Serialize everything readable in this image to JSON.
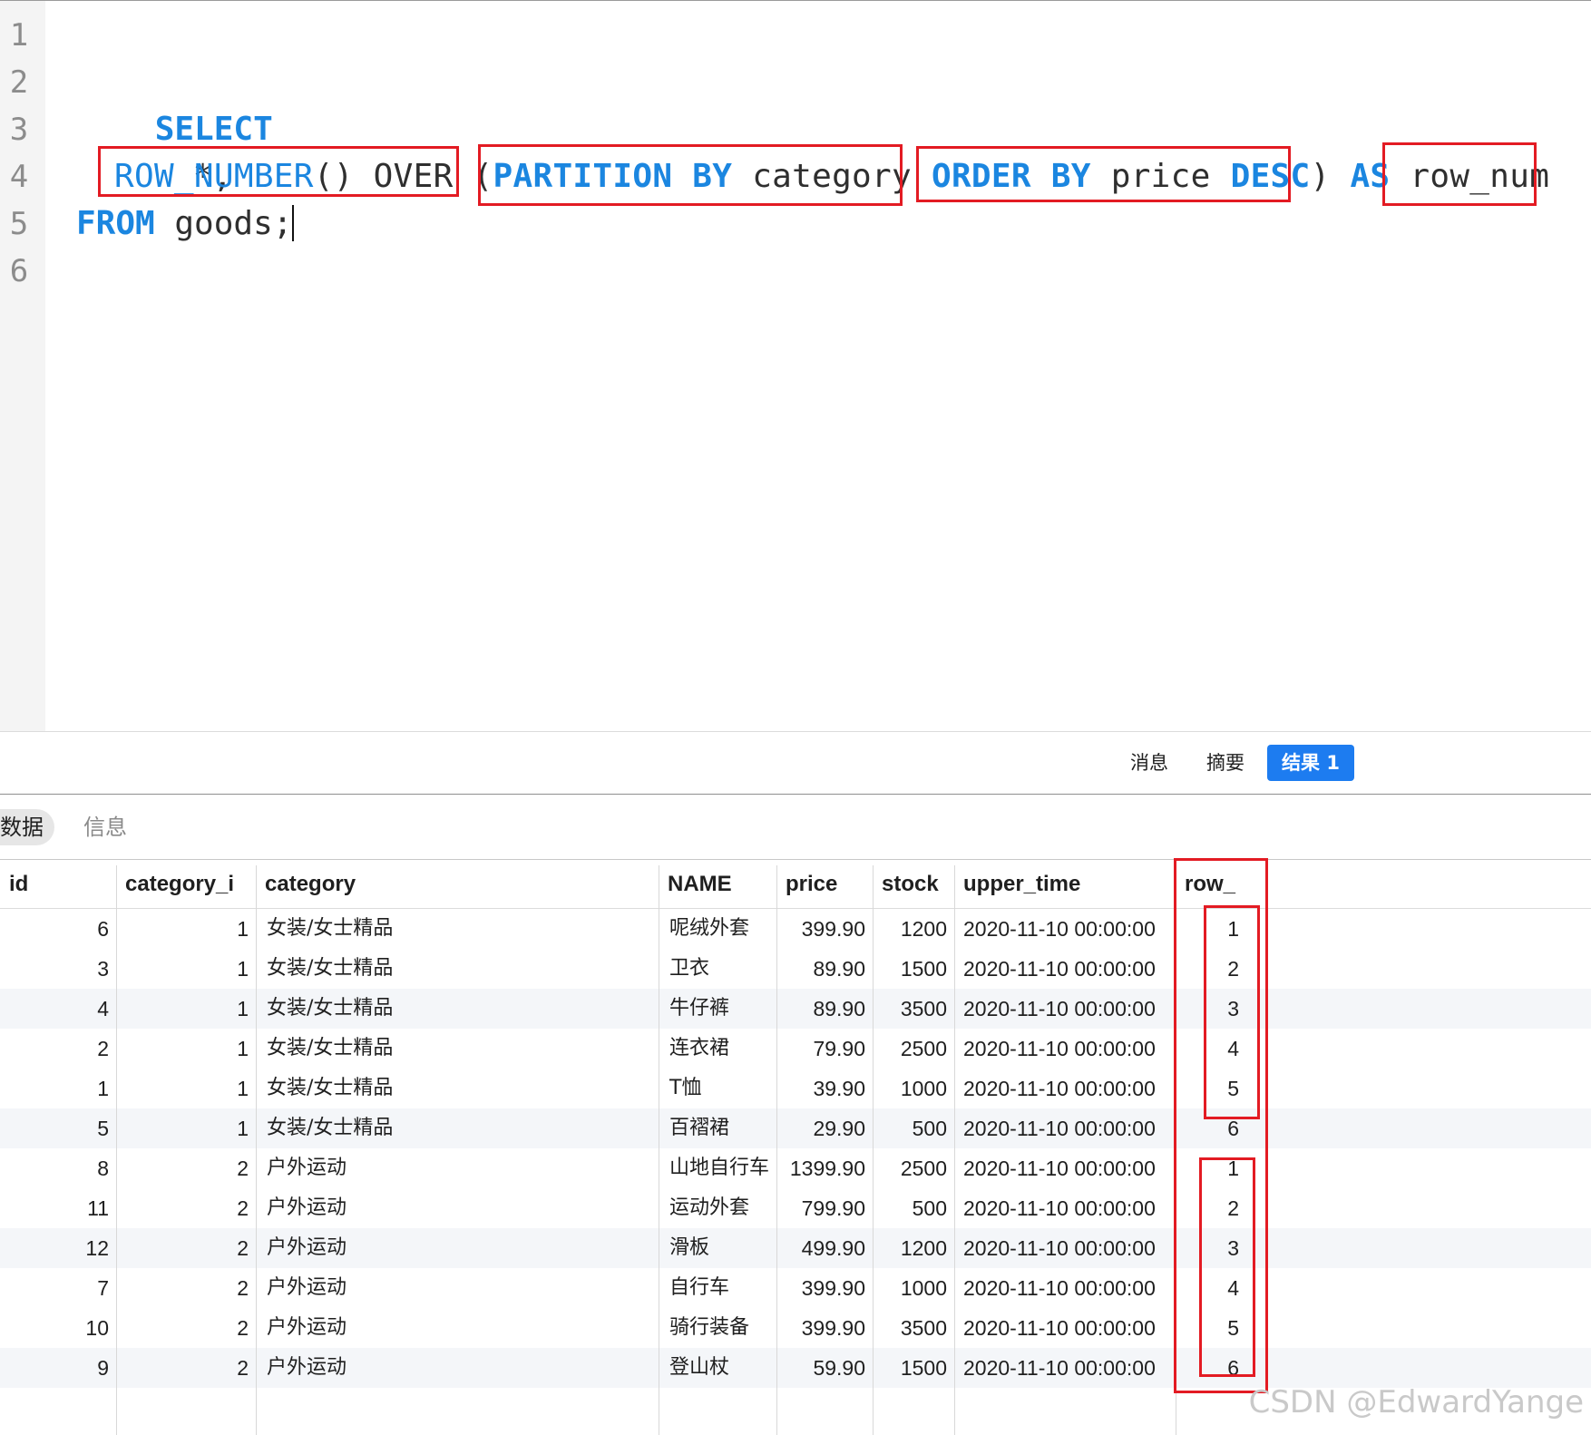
{
  "editor": {
    "line_numbers": [
      "1",
      "2",
      "3",
      "4",
      "5",
      "6"
    ],
    "line2": {
      "kw_select": "SELECT"
    },
    "line3": {
      "star": "*,"
    },
    "line4": {
      "fn_row_number": "ROW_NUMBER",
      "parens": "()",
      "over": " OVER ",
      "open_paren": "(",
      "kw_partition": "PARTITION BY",
      "col_category": " category ",
      "kw_order": "ORDER BY",
      "col_price": " price ",
      "kw_desc": "DESC",
      "close_paren": ")",
      "kw_as": " AS ",
      "alias": "row_num"
    },
    "line5": {
      "kw_from": "FROM",
      "table": " goods;"
    }
  },
  "result_tabs": {
    "message": "消息",
    "summary": "摘要",
    "result1": "结果 1"
  },
  "sub_tabs": {
    "data": "数据",
    "info": "信息"
  },
  "grid": {
    "columns": [
      "id",
      "category_i",
      "category",
      "NAME",
      "price",
      "stock",
      "upper_time",
      "row_"
    ],
    "rows": [
      [
        "6",
        "1",
        "女装/女士精品",
        "呢绒外套",
        "399.90",
        "1200",
        "2020-11-10 00:00:00",
        "1"
      ],
      [
        "3",
        "1",
        "女装/女士精品",
        "卫衣",
        "89.90",
        "1500",
        "2020-11-10 00:00:00",
        "2"
      ],
      [
        "4",
        "1",
        "女装/女士精品",
        "牛仔裤",
        "89.90",
        "3500",
        "2020-11-10 00:00:00",
        "3"
      ],
      [
        "2",
        "1",
        "女装/女士精品",
        "连衣裙",
        "79.90",
        "2500",
        "2020-11-10 00:00:00",
        "4"
      ],
      [
        "1",
        "1",
        "女装/女士精品",
        "T恤",
        "39.90",
        "1000",
        "2020-11-10 00:00:00",
        "5"
      ],
      [
        "5",
        "1",
        "女装/女士精品",
        "百褶裙",
        "29.90",
        "500",
        "2020-11-10 00:00:00",
        "6"
      ],
      [
        "8",
        "2",
        "户外运动",
        "山地自行车",
        "1399.90",
        "2500",
        "2020-11-10 00:00:00",
        "1"
      ],
      [
        "11",
        "2",
        "户外运动",
        "运动外套",
        "799.90",
        "500",
        "2020-11-10 00:00:00",
        "2"
      ],
      [
        "12",
        "2",
        "户外运动",
        "滑板",
        "499.90",
        "1200",
        "2020-11-10 00:00:00",
        "3"
      ],
      [
        "7",
        "2",
        "户外运动",
        "自行车",
        "399.90",
        "1000",
        "2020-11-10 00:00:00",
        "4"
      ],
      [
        "10",
        "2",
        "户外运动",
        "骑行装备",
        "399.90",
        "3500",
        "2020-11-10 00:00:00",
        "5"
      ],
      [
        "9",
        "2",
        "户外运动",
        "登山杖",
        "59.90",
        "1500",
        "2020-11-10 00:00:00",
        "6"
      ]
    ]
  },
  "watermark": "CSDN @EdwardYange",
  "colors": {
    "keyword": "#1b86e0",
    "highlight": "#e31b23",
    "active_tab": "#1d7cf0"
  }
}
